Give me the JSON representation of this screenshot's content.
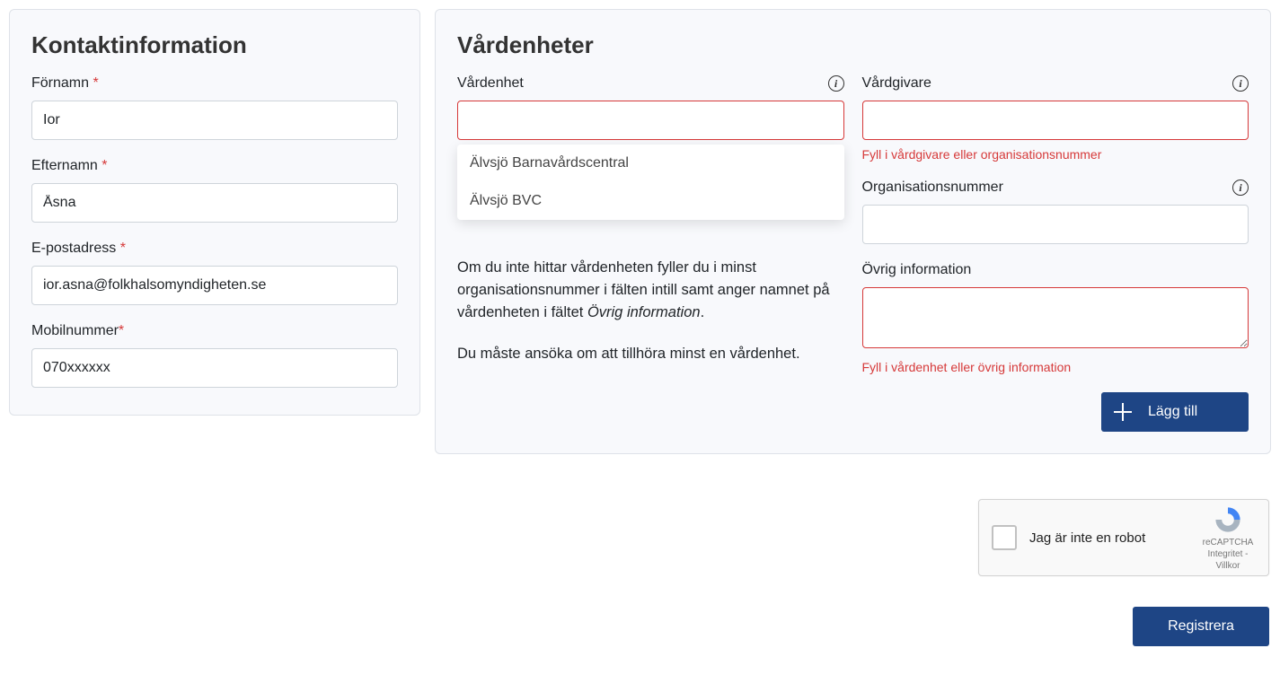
{
  "contact": {
    "title": "Kontaktinformation",
    "first_name_label": "Förnamn",
    "first_name_value": "Ior",
    "last_name_label": "Efternamn",
    "last_name_value": "Åsna",
    "email_label": "E-postadress",
    "email_value": "ior.asna@folkhalsomyndigheten.se",
    "mobile_label": "Mobilnummer",
    "mobile_value": "070xxxxxx"
  },
  "units": {
    "title": "Vårdenheter",
    "unit_label": "Vårdenhet",
    "unit_value": "",
    "suggestions": [
      "Älvsjö Barnavårdscentral",
      "Älvsjö BVC"
    ],
    "help1_a": "Om du inte hittar vårdenheten fyller du i minst organisationsnummer i fälten intill samt anger namnet på vårdenheten i fältet ",
    "help1_em": "Övrig information",
    "help1_b": ".",
    "help2": "Du måste ansöka om att tillhöra minst en vårdenhet.",
    "provider_label": "Vårdgivare",
    "provider_value": "",
    "provider_error": "Fyll i vårdgivare eller organisationsnummer",
    "orgno_label": "Organisationsnummer",
    "orgno_value": "",
    "other_label": "Övrig information",
    "other_value": "",
    "other_error": "Fyll i vårdenhet eller övrig information",
    "add_button": "Lägg till"
  },
  "recaptcha": {
    "label": "Jag är inte en robot",
    "brand": "reCAPTCHA",
    "privacy": "Integritet",
    "terms": "Villkor"
  },
  "register_button": "Registrera",
  "asterisk": " *",
  "asterisk_tight": "*",
  "info_glyph": "i"
}
